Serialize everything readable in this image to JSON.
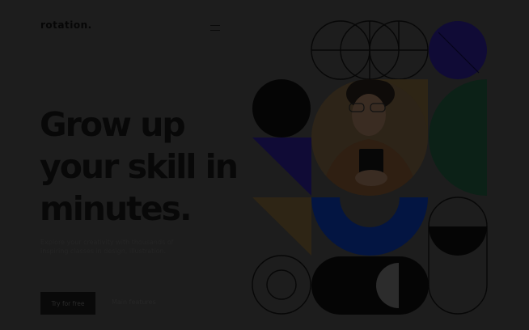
{
  "header": {
    "logo": "rotation.",
    "menu_icon": "hamburger-icon"
  },
  "hero": {
    "headline": [
      "Grow up",
      "your skill in",
      "minutes."
    ],
    "subtitle": [
      "Explore your creativity with thousands of",
      "inspiring classes in design, illustration."
    ],
    "primary_button": "Try for free",
    "secondary_link": "Main features"
  },
  "colors": {
    "background": "#1d1d1d",
    "navy": "#100b36",
    "blue": "#031542",
    "green": "#0c2117",
    "ochre": "#2e2515",
    "black": "#050505"
  }
}
